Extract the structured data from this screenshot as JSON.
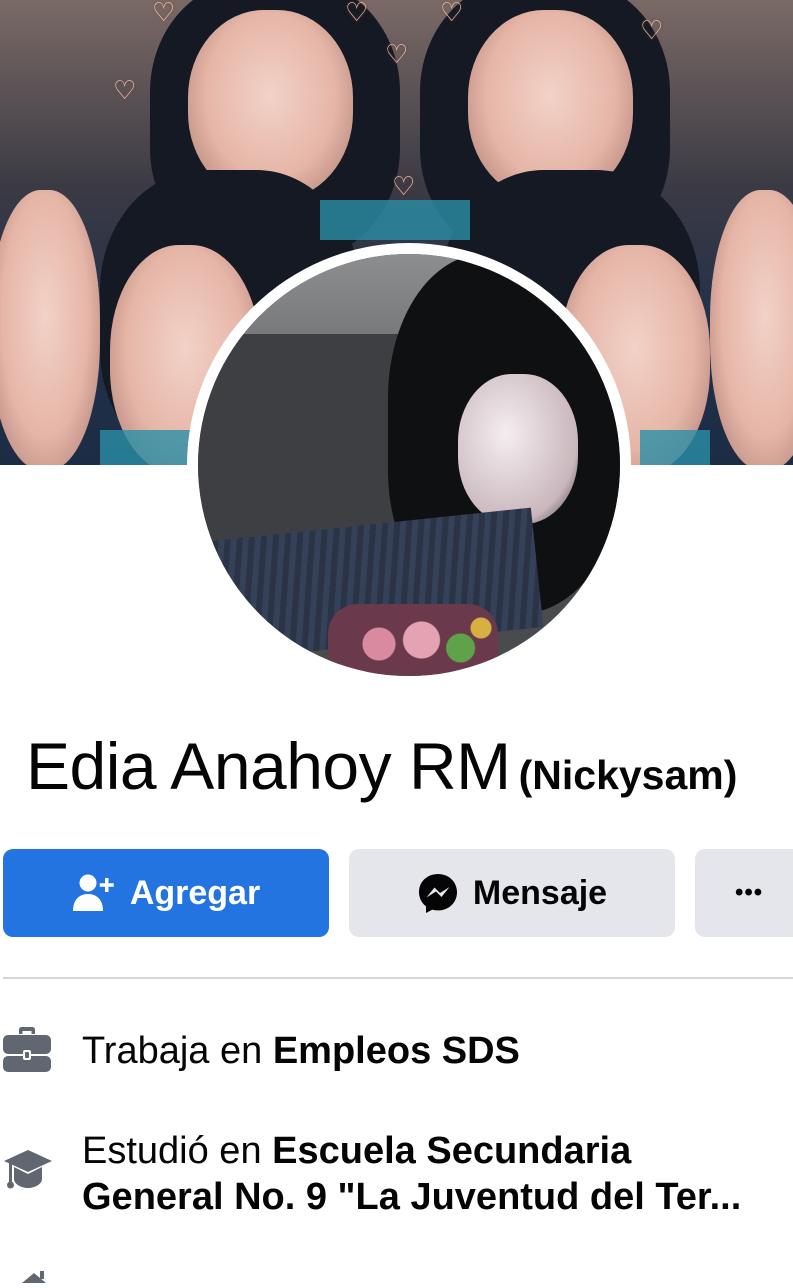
{
  "profile": {
    "name": "Edia Anahoy RM",
    "nickname": "(Nickysam)"
  },
  "actions": {
    "add_label": "Agregar",
    "message_label": "Mensaje",
    "more_label": "•••"
  },
  "intro": {
    "work": {
      "prefix": "Trabaja en ",
      "place": "Empleos SDS",
      "icon": "briefcase-icon"
    },
    "education": {
      "prefix": "Estudió en ",
      "place_line1": "Escuela Secundaria",
      "place_line2": "General No. 9 \"La Juventud del Ter...",
      "icon": "graduation-cap-icon"
    },
    "home": {
      "icon": "home-icon"
    }
  },
  "colors": {
    "accent": "#2374e1",
    "secondary_button": "#e4e6eb",
    "text": "#050505",
    "icon_gray": "#606770"
  }
}
